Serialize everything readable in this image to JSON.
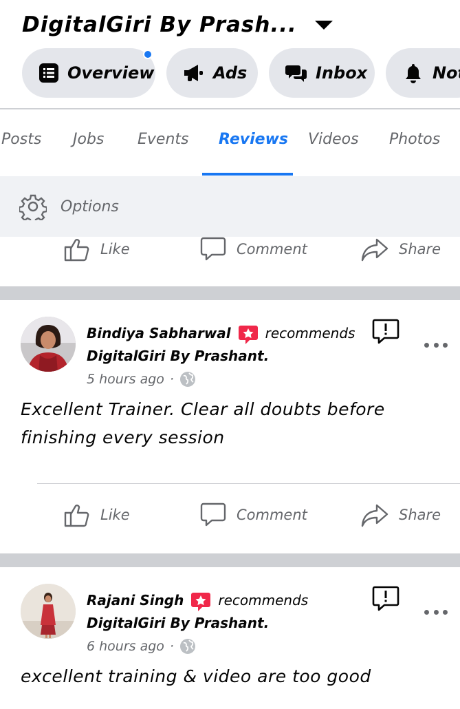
{
  "header": {
    "page_title": "DigitalGiri By Prash...",
    "pills": [
      {
        "label": "Overview",
        "icon": "list-icon",
        "has_notification_dot": true
      },
      {
        "label": "Ads",
        "icon": "megaphone-icon"
      },
      {
        "label": "Inbox",
        "icon": "messages-icon"
      },
      {
        "label": "Not",
        "icon": "bell-icon"
      }
    ]
  },
  "tabs": [
    "Posts",
    "Jobs",
    "Events",
    "Reviews",
    "Videos",
    "Photos"
  ],
  "active_tab": "Reviews",
  "options": {
    "label": "Options"
  },
  "actions": {
    "like": "Like",
    "comment": "Comment",
    "share": "Share"
  },
  "posts": [
    {
      "name": "Bindiya Sabharwal",
      "verb": "recommends",
      "page": "DigitalGiri By Prashant.",
      "time": "5 hours ago",
      "text": "Excellent Trainer. Clear all doubts before finishing every session"
    },
    {
      "name": "Rajani Singh",
      "verb": "recommends",
      "page": "DigitalGiri By Prashant.",
      "time": "6 hours ago",
      "text": "excellent training & video are too good"
    }
  ],
  "colors": {
    "accent": "#1877f2",
    "recommend_badge": "#f0284a",
    "muted": "#65676b",
    "separator": "#ced0d4"
  }
}
